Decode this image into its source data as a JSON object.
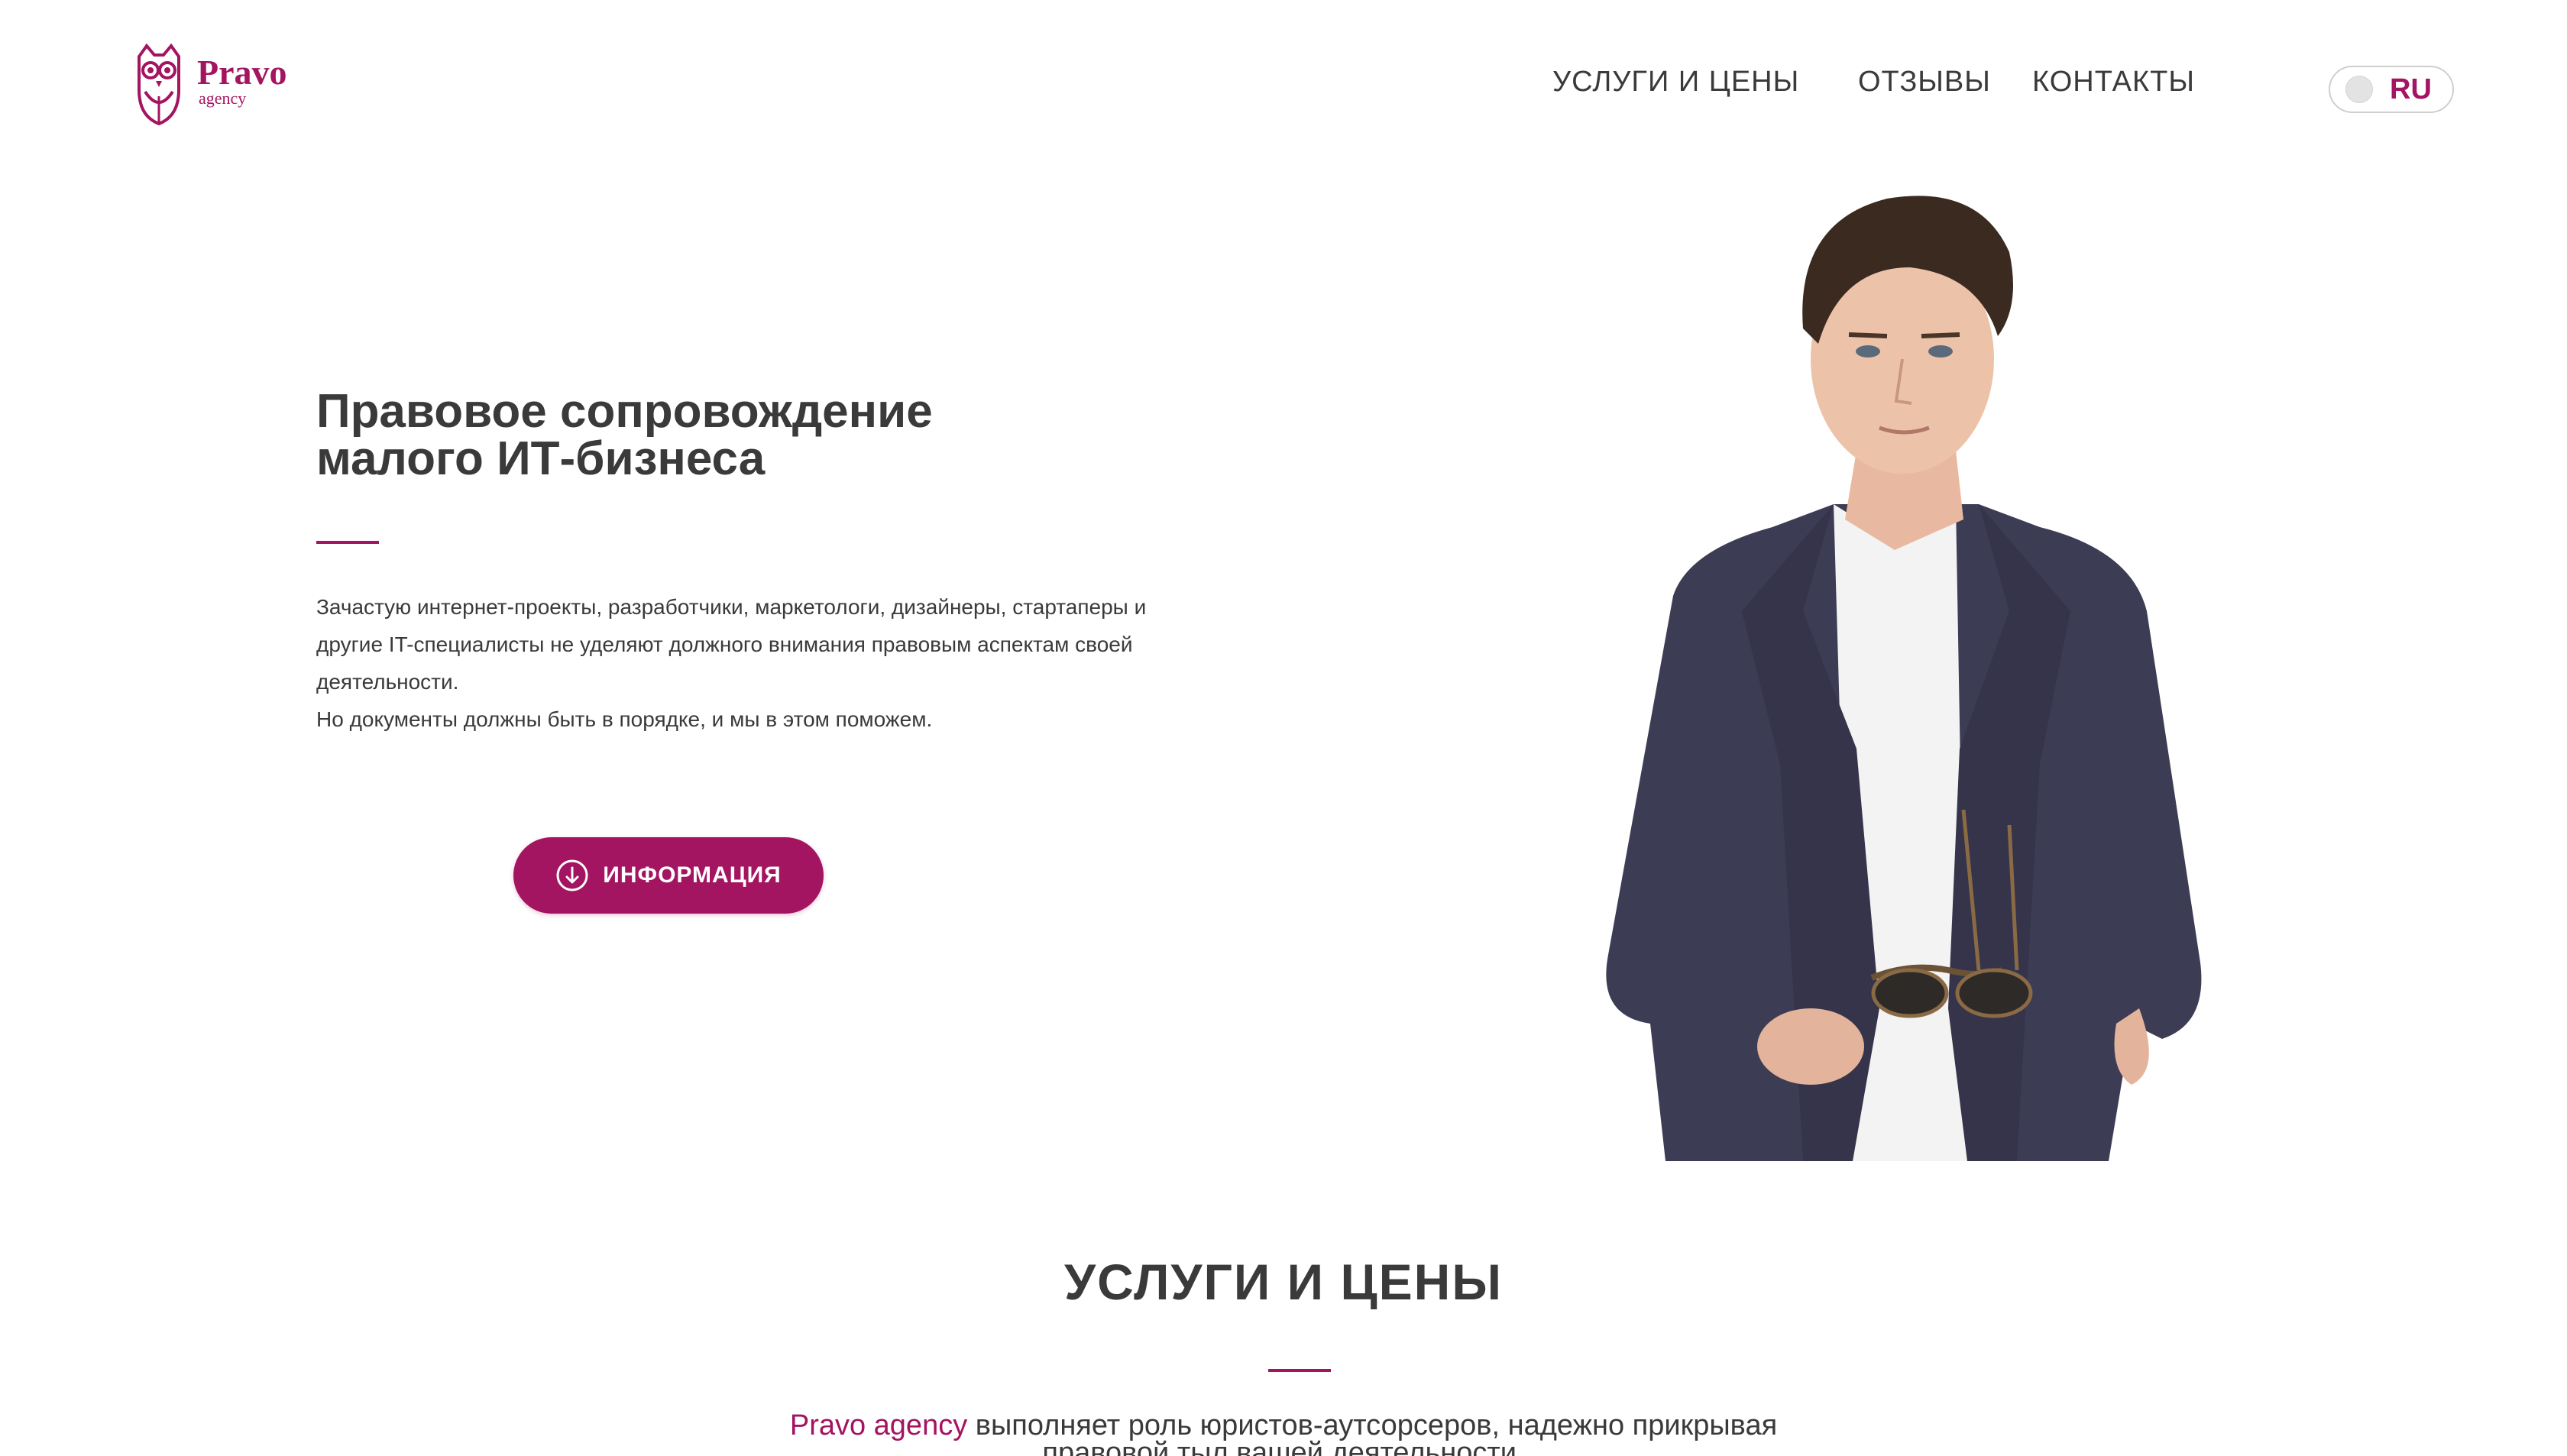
{
  "header": {
    "logo": {
      "name": "Pravo",
      "sub": "agency"
    },
    "nav": [
      {
        "label": "УСЛУГИ И ЦЕНЫ"
      },
      {
        "label": "ОТЗЫВЫ"
      },
      {
        "label": "КОНТАКТЫ"
      }
    ],
    "language": {
      "label": "RU"
    }
  },
  "hero": {
    "title_line1": "Правовое сопровождение",
    "title_line2": "малого ИТ-бизнеса",
    "desc_line1": "Зачастую интернет-проекты, разработчики, маркетологи, дизайнеры, стартаперы и",
    "desc_line2": "другие IT-специалисты не уделяют должного внимания правовым аспектам своей",
    "desc_line3": "деятельности.",
    "desc_line4": "Но документы должны быть в порядке, и мы в этом поможем.",
    "button_label": "ИНФОРМАЦИЯ",
    "button_icon": "arrow-down-circle-icon"
  },
  "services": {
    "title": "УСЛУГИ И ЦЕНЫ",
    "brand": "Pravo agency",
    "desc_rest": " выполняет роль юристов-аутсорсеров, надежно прикрывая",
    "desc_line2": "правовой тыл вашей деятельности."
  },
  "colors": {
    "accent": "#a31461",
    "text": "#3a3a3a",
    "background": "#ffffff"
  }
}
